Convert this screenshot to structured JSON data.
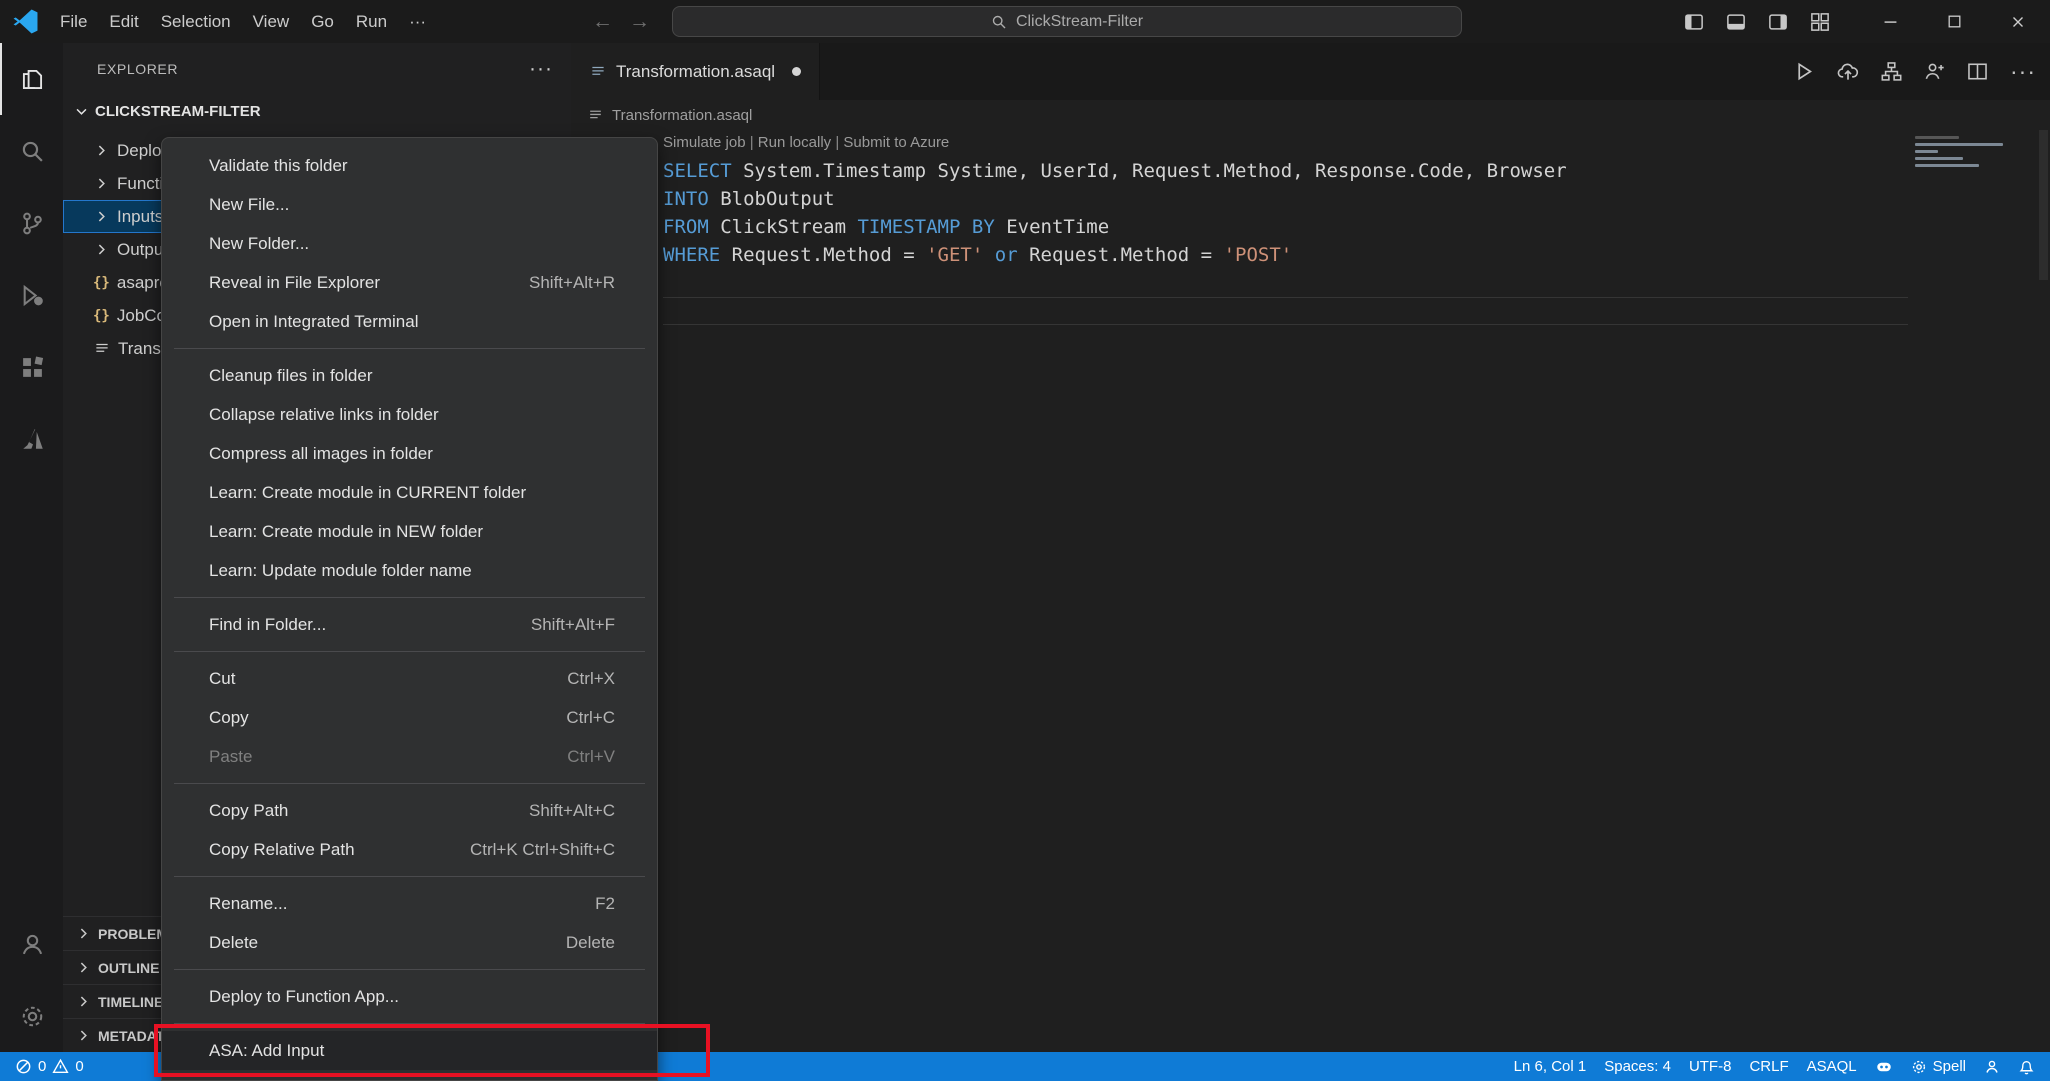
{
  "colors": {
    "accent": "#2477cc",
    "statusbar_bg": "#0f7bd6",
    "keyword": "#569cd6",
    "string": "#ce9178",
    "plain": "#d4d4d4",
    "annotation": "#e81123"
  },
  "titlebar": {
    "menus": [
      "File",
      "Edit",
      "Selection",
      "View",
      "Go",
      "Run",
      "···"
    ],
    "back_arrow": "←",
    "forward_arrow": "→",
    "search_label": "ClickStream-Filter"
  },
  "activitybar": {
    "top": [
      {
        "name": "explorer",
        "icon": "files",
        "active": true
      },
      {
        "name": "search",
        "icon": "search",
        "active": false
      },
      {
        "name": "source-control",
        "icon": "scm",
        "active": false
      },
      {
        "name": "run-debug",
        "icon": "debug",
        "active": false
      },
      {
        "name": "extensions",
        "icon": "extensions",
        "active": false
      },
      {
        "name": "azure",
        "icon": "azure",
        "active": false
      }
    ],
    "bottom": [
      {
        "name": "accounts",
        "icon": "account",
        "active": false
      },
      {
        "name": "settings",
        "icon": "gear",
        "active": false
      }
    ]
  },
  "sidebar": {
    "title": "EXPLORER",
    "actions_label": "···",
    "folder": "CLICKSTREAM-FILTER",
    "tree": [
      {
        "label": "Deploy",
        "kind": "folder",
        "selected": false
      },
      {
        "label": "Functions",
        "kind": "folder",
        "selected": false
      },
      {
        "label": "Inputs",
        "kind": "folder",
        "selected": true
      },
      {
        "label": "Outputs",
        "kind": "folder",
        "selected": false
      },
      {
        "label": "asaproj.json",
        "kind": "json",
        "selected": false
      },
      {
        "label": "JobConfig.json",
        "kind": "json",
        "selected": false
      },
      {
        "label": "Transformation.asaql",
        "kind": "file",
        "selected": false
      }
    ],
    "panels": [
      "PROBLEMS",
      "OUTLINE",
      "TIMELINE",
      "METADATA"
    ]
  },
  "tab": {
    "label": "Transformation.asaql",
    "modified": true
  },
  "breadcrumb": {
    "file": "Transformation.asaql"
  },
  "editor": {
    "codelens": [
      "Simulate job",
      "Run locally",
      "Submit to Azure"
    ],
    "codelens_separator": " | ",
    "lines": [
      [
        {
          "t": "SELECT",
          "c": "kw"
        },
        {
          "t": " System.Timestamp Systime, UserId, Request.Method, Response.Code, Browser",
          "c": "pl"
        }
      ],
      [
        {
          "t": "INTO",
          "c": "kw"
        },
        {
          "t": " BlobOutput",
          "c": "pl"
        }
      ],
      [
        {
          "t": "FROM",
          "c": "kw"
        },
        {
          "t": " ClickStream ",
          "c": "pl"
        },
        {
          "t": "TIMESTAMP",
          "c": "kw"
        },
        {
          "t": " ",
          "c": "pl"
        },
        {
          "t": "BY",
          "c": "kw"
        },
        {
          "t": " EventTime",
          "c": "pl"
        }
      ],
      [
        {
          "t": "WHERE",
          "c": "kw"
        },
        {
          "t": " Request.Method = ",
          "c": "pl"
        },
        {
          "t": "'GET'",
          "c": "str"
        },
        {
          "t": " ",
          "c": "pl"
        },
        {
          "t": "or",
          "c": "kw"
        },
        {
          "t": " Request.Method = ",
          "c": "pl"
        },
        {
          "t": "'POST'",
          "c": "str"
        }
      ]
    ]
  },
  "editor_actions": [
    {
      "name": "run",
      "icon": "play"
    },
    {
      "name": "upload-to-azure",
      "icon": "cloud-up"
    },
    {
      "name": "query-diagram",
      "icon": "diagram"
    },
    {
      "name": "add-account",
      "icon": "person"
    },
    {
      "name": "split-editor",
      "icon": "split"
    },
    {
      "name": "more-actions",
      "icon": "ellipsis"
    }
  ],
  "context_menu": {
    "groups": [
      [
        {
          "label": "Validate this folder"
        },
        {
          "label": "New File..."
        },
        {
          "label": "New Folder..."
        },
        {
          "label": "Reveal in File Explorer",
          "shortcut": "Shift+Alt+R"
        },
        {
          "label": "Open in Integrated Terminal"
        }
      ],
      [
        {
          "label": "Cleanup files in folder"
        },
        {
          "label": "Collapse relative links in folder"
        },
        {
          "label": "Compress all images in folder"
        },
        {
          "label": "Learn: Create module in CURRENT folder"
        },
        {
          "label": "Learn: Create module in NEW folder"
        },
        {
          "label": "Learn: Update module folder name"
        }
      ],
      [
        {
          "label": "Find in Folder...",
          "shortcut": "Shift+Alt+F"
        }
      ],
      [
        {
          "label": "Cut",
          "shortcut": "Ctrl+X"
        },
        {
          "label": "Copy",
          "shortcut": "Ctrl+C"
        },
        {
          "label": "Paste",
          "shortcut": "Ctrl+V",
          "disabled": true
        }
      ],
      [
        {
          "label": "Copy Path",
          "shortcut": "Shift+Alt+C"
        },
        {
          "label": "Copy Relative Path",
          "shortcut": "Ctrl+K Ctrl+Shift+C"
        }
      ],
      [
        {
          "label": "Rename...",
          "shortcut": "F2"
        },
        {
          "label": "Delete",
          "shortcut": "Delete"
        }
      ],
      [
        {
          "label": "Deploy to Function App..."
        }
      ],
      [
        {
          "label": "ASA: Add Input",
          "annotated": true
        }
      ]
    ]
  },
  "statusbar": {
    "problems": {
      "errors": "0",
      "warnings": "0"
    },
    "right": [
      {
        "name": "cursor-position",
        "label": "Ln 6, Col 1"
      },
      {
        "name": "indentation",
        "label": "Spaces: 4"
      },
      {
        "name": "encoding",
        "label": "UTF-8"
      },
      {
        "name": "eol",
        "label": "CRLF"
      },
      {
        "name": "language-mode",
        "label": "ASAQL"
      },
      {
        "name": "copilot",
        "icon": "copilot"
      },
      {
        "name": "spell-checker",
        "icon": "gear-sm",
        "label": "Spell"
      },
      {
        "name": "feedback",
        "icon": "person-sm"
      },
      {
        "name": "notifications",
        "icon": "bell"
      }
    ]
  },
  "annotation": {
    "target": "ASA: Add Input"
  }
}
